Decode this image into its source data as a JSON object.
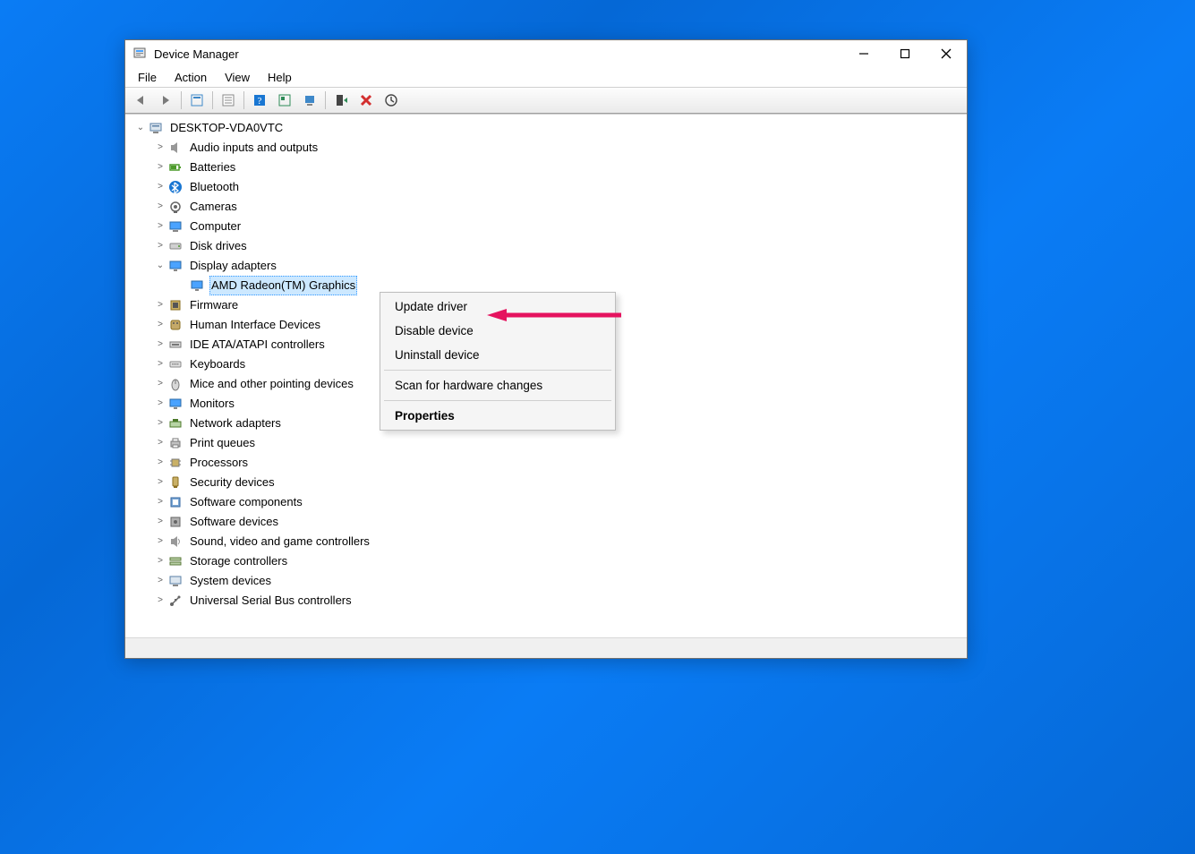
{
  "window": {
    "title": "Device Manager"
  },
  "menubar": {
    "file": "File",
    "action": "Action",
    "view": "View",
    "help": "Help"
  },
  "tree": {
    "root": "DESKTOP-VDA0VTC",
    "items": [
      {
        "label": "Audio inputs and outputs",
        "icon": "speaker"
      },
      {
        "label": "Batteries",
        "icon": "battery"
      },
      {
        "label": "Bluetooth",
        "icon": "bluetooth"
      },
      {
        "label": "Cameras",
        "icon": "camera"
      },
      {
        "label": "Computer",
        "icon": "computer"
      },
      {
        "label": "Disk drives",
        "icon": "disk"
      },
      {
        "label": "Display adapters",
        "icon": "display",
        "expanded": true,
        "children": [
          {
            "label": "AMD Radeon(TM) Graphics",
            "icon": "display",
            "selected": true
          }
        ]
      },
      {
        "label": "Firmware",
        "icon": "firmware"
      },
      {
        "label": "Human Interface Devices",
        "icon": "hid"
      },
      {
        "label": "IDE ATA/ATAPI controllers",
        "icon": "ide"
      },
      {
        "label": "Keyboards",
        "icon": "keyboard"
      },
      {
        "label": "Mice and other pointing devices",
        "icon": "mouse"
      },
      {
        "label": "Monitors",
        "icon": "monitor"
      },
      {
        "label": "Network adapters",
        "icon": "network"
      },
      {
        "label": "Print queues",
        "icon": "printer"
      },
      {
        "label": "Processors",
        "icon": "cpu"
      },
      {
        "label": "Security devices",
        "icon": "security"
      },
      {
        "label": "Software components",
        "icon": "swcomp"
      },
      {
        "label": "Software devices",
        "icon": "swdev"
      },
      {
        "label": "Sound, video and game controllers",
        "icon": "sound"
      },
      {
        "label": "Storage controllers",
        "icon": "storage"
      },
      {
        "label": "System devices",
        "icon": "system"
      },
      {
        "label": "Universal Serial Bus controllers",
        "icon": "usb"
      }
    ]
  },
  "context_menu": {
    "update": "Update driver",
    "disable": "Disable device",
    "uninstall": "Uninstall device",
    "scan": "Scan for hardware changes",
    "properties": "Properties"
  },
  "icons": {
    "computer-small": "computer-icon",
    "back": "back-arrow-icon",
    "forward": "forward-arrow-icon",
    "show-hidden": "show-hidden-icon",
    "properties": "properties-icon",
    "help": "help-icon",
    "details": "details-icon",
    "scan": "scan-icon",
    "enable": "enable-device-icon",
    "delete": "delete-icon",
    "update": "update-icon"
  }
}
